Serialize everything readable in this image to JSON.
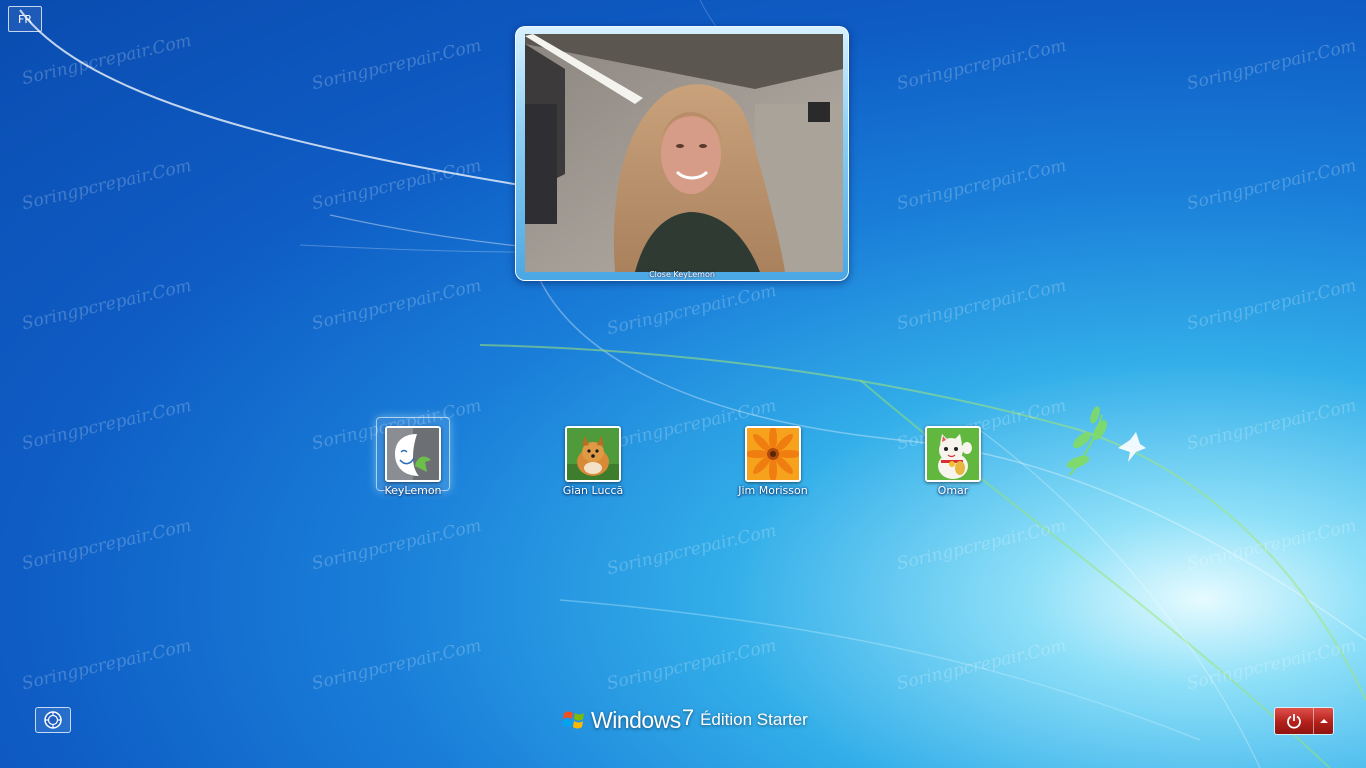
{
  "language_button": {
    "label": "FR"
  },
  "webcam": {
    "caption": "Close KeyLemon"
  },
  "users": [
    {
      "name": "KeyLemon",
      "picture": "keylemon-logo",
      "selected": true
    },
    {
      "name": "Gian Luccā",
      "picture": "pomeranian-dog"
    },
    {
      "name": "Jim Morisson",
      "picture": "orange-flower"
    },
    {
      "name": "Omar",
      "picture": "lucky-cat"
    }
  ],
  "branding": {
    "product": "Windows",
    "version": "7",
    "edition": "Édition Starter"
  },
  "watermark": {
    "text": "Soringpcrepair.Com"
  },
  "icons": {
    "ease_of_access": "ease-of-access-icon",
    "power": "power-icon",
    "power_options": "chevron-up-icon"
  },
  "colors": {
    "background": "#1a7fd9",
    "power_button": "#b3201b"
  }
}
